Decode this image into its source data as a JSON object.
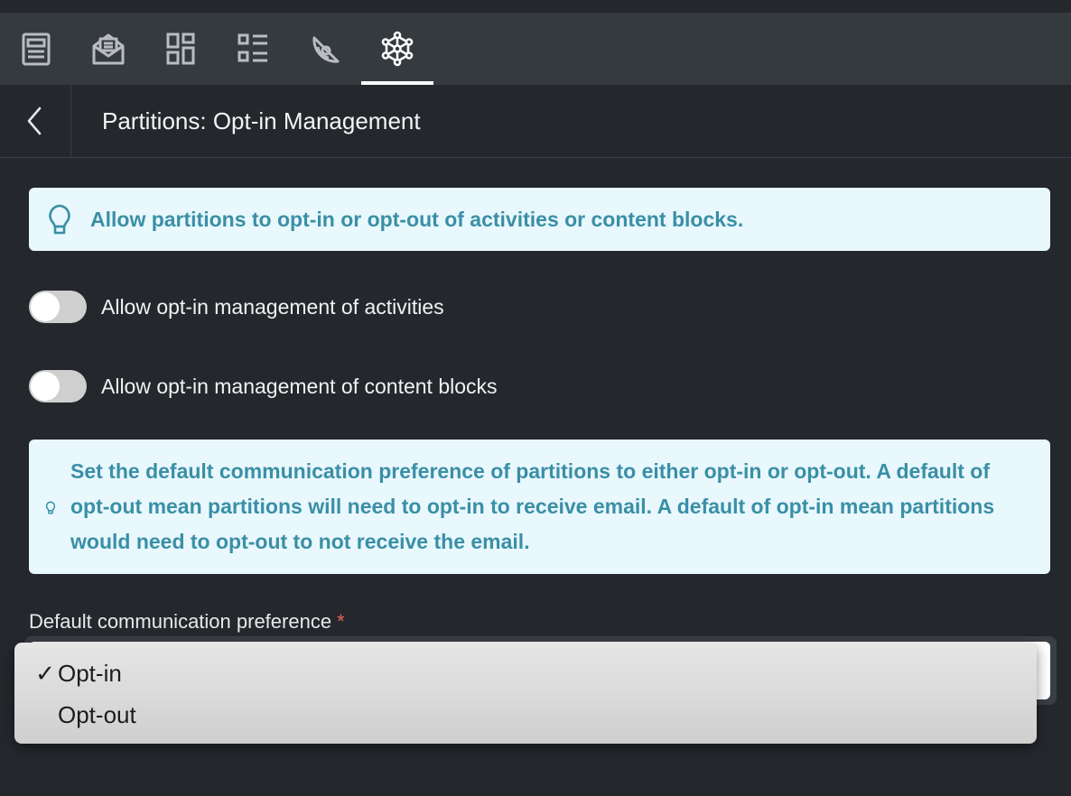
{
  "tabs": [
    {
      "icon": "document-icon",
      "active": false
    },
    {
      "icon": "email-icon",
      "active": false
    },
    {
      "icon": "dashboard-icon",
      "active": false
    },
    {
      "icon": "list-icon",
      "active": false
    },
    {
      "icon": "pie-chart-icon",
      "active": false
    },
    {
      "icon": "network-settings-icon",
      "active": true
    }
  ],
  "header": {
    "back_icon": "chevron-left-icon",
    "title": "Partitions: Opt-in Management"
  },
  "info_top": {
    "icon": "lightbulb-icon",
    "text": "Allow partitions to opt-in or opt-out of activities or content blocks."
  },
  "toggles": {
    "activities": {
      "label": "Allow opt-in management of activities",
      "on": false
    },
    "content_blocks": {
      "label": "Allow opt-in management of content blocks",
      "on": false
    }
  },
  "info_default": {
    "icon": "lightbulb-icon",
    "text": "Set the default communication preference of partitions to either opt-in or opt-out. A default of opt-out mean partitions will need to opt-in to receive email. A default of opt-in mean partitions would need to opt-out to not receive the email."
  },
  "preference": {
    "label": "Default communication preference",
    "required_mark": "*",
    "options": [
      {
        "label": "Opt-in",
        "checkmark": "✓",
        "selected": true
      },
      {
        "label": "Opt-out",
        "checkmark": "",
        "selected": false
      }
    ]
  },
  "colors": {
    "background": "#24272c",
    "tabbar": "#353a3f",
    "info_bg": "#e8f8fd",
    "info_text": "#3a8fa6",
    "required": "#e2685e"
  }
}
